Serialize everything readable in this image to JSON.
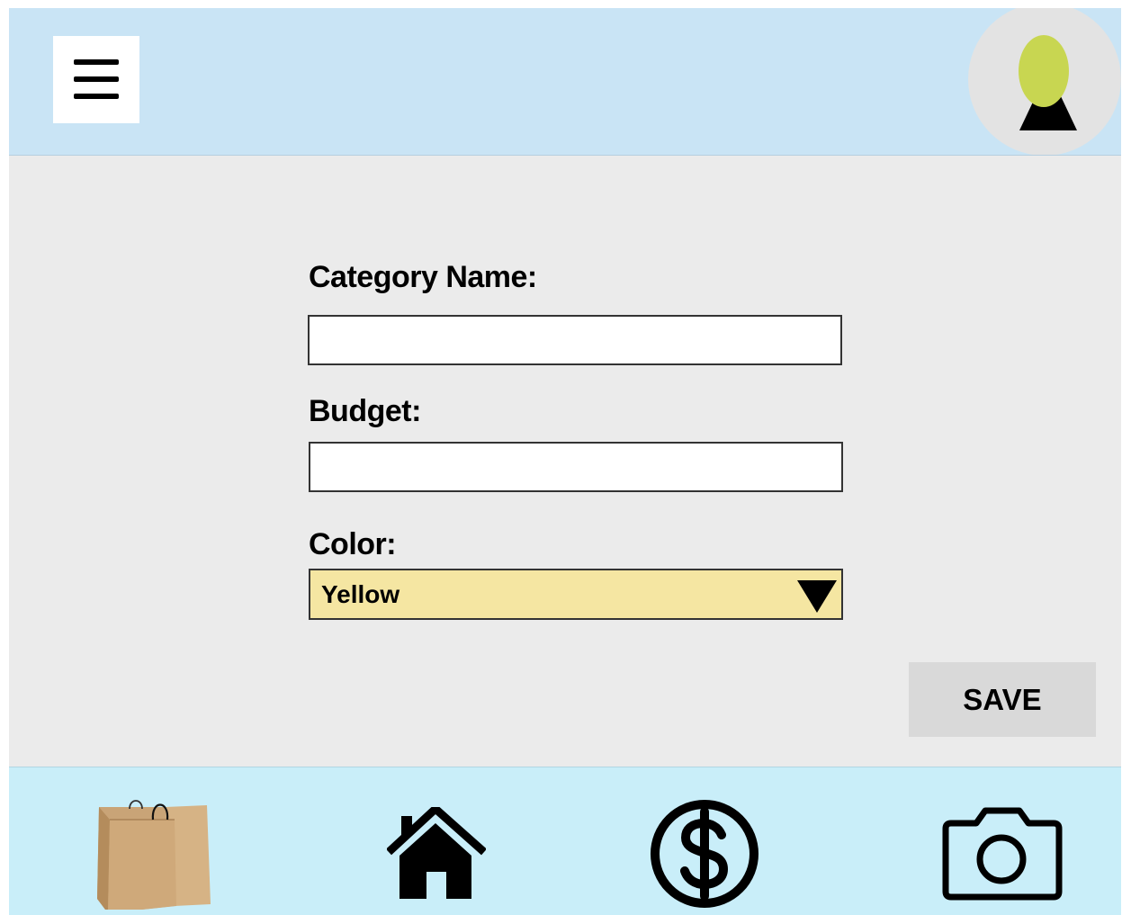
{
  "header": {
    "menu_icon": "hamburger-menu-icon",
    "avatar_icon": "user-avatar-icon"
  },
  "form": {
    "category_label": "Category Name:",
    "category_value": "",
    "budget_label": "Budget:",
    "budget_value": "",
    "color_label": "Color:",
    "color_selected": "Yellow",
    "color_swatch": "#f5e6a2",
    "save_label": "SAVE"
  },
  "bottom_nav": {
    "items": [
      {
        "icon": "shopping-bag-icon"
      },
      {
        "icon": "home-icon"
      },
      {
        "icon": "dollar-icon"
      },
      {
        "icon": "camera-icon"
      }
    ]
  },
  "colors": {
    "header_bg": "#c9e4f5",
    "nav_bg": "#c9eef9",
    "content_bg": "#ebebeb",
    "avatar_head": "#c8d651"
  }
}
